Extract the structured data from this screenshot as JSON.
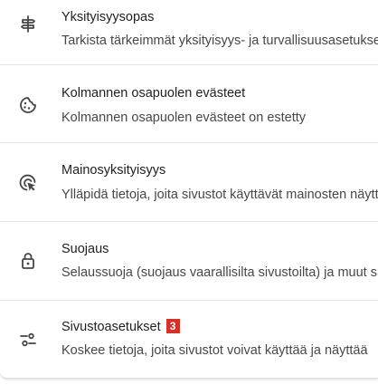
{
  "items": [
    {
      "icon": "tune-sliders-icon",
      "title": "Yksityisyysopas",
      "subtitle": "Tarkista tärkeimmät yksityisyys- ja turvallisuusasetukset"
    },
    {
      "icon": "cookie-icon",
      "title": "Kolmannen osapuolen evästeet",
      "subtitle": "Kolmannen osapuolen evästeet on estetty"
    },
    {
      "icon": "ad-privacy-icon",
      "title": "Mainosyksityisyys",
      "subtitle": "Ylläpidä tietoja, joita sivustot käyttävät mainosten näyttämiseen"
    },
    {
      "icon": "lock-icon",
      "title": "Suojaus",
      "subtitle": "Selaussuoja (suojaus vaarallisilta sivustoilta) ja muut suojausasetukset"
    },
    {
      "icon": "site-settings-icon",
      "title": "Sivustoasetukset",
      "badge": "3",
      "subtitle": "Koskee tietoja, joita sivustot voivat käyttää ja näyttää"
    }
  ],
  "colors": {
    "badge": "#d93025",
    "icon": "#444746",
    "divider": "#e3e3e3"
  }
}
